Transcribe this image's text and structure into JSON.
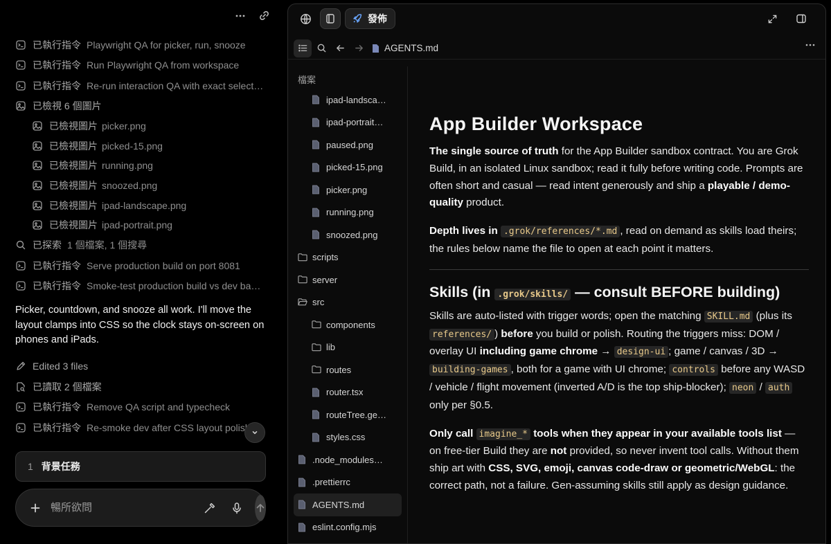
{
  "chat": {
    "log": [
      {
        "icon": "terminal-icon",
        "label": "已執行指令",
        "detail": "Playwright QA for picker, run, snooze"
      },
      {
        "icon": "terminal-icon",
        "label": "已執行指令",
        "detail": "Run Playwright QA from workspace"
      },
      {
        "icon": "terminal-icon",
        "label": "已執行指令",
        "detail": "Re-run interaction QA with exact select…"
      },
      {
        "icon": "image-icon",
        "label": "已檢視 6 個圖片",
        "detail": ""
      }
    ],
    "images": [
      {
        "label": "已檢視圖片",
        "detail": "picker.png"
      },
      {
        "label": "已檢視圖片",
        "detail": "picked-15.png"
      },
      {
        "label": "已檢視圖片",
        "detail": "running.png"
      },
      {
        "label": "已檢視圖片",
        "detail": "snoozed.png"
      },
      {
        "label": "已檢視圖片",
        "detail": "ipad-landscape.png"
      },
      {
        "label": "已檢視圖片",
        "detail": "ipad-portrait.png"
      }
    ],
    "log2": [
      {
        "icon": "search-icon",
        "label": "已探索",
        "detail": "1 個檔案, 1 個搜尋"
      },
      {
        "icon": "terminal-icon",
        "label": "已執行指令",
        "detail": "Serve production build on port 8081"
      },
      {
        "icon": "terminal-icon",
        "label": "已執行指令",
        "detail": "Smoke-test production build vs dev ba…"
      }
    ],
    "message": "Picker, countdown, and snooze all work. I'll move the layout clamps into CSS so the clock stays on-screen on phones and iPads.",
    "log3": [
      {
        "icon": "pencil-icon",
        "label": "Edited 3 files",
        "detail": ""
      },
      {
        "icon": "file-search-icon",
        "label": "已讀取 2 個檔案",
        "detail": ""
      },
      {
        "icon": "terminal-icon",
        "label": "已執行指令",
        "detail": "Remove QA script and typecheck"
      },
      {
        "icon": "terminal-icon",
        "label": "已執行指令",
        "detail": "Re-smoke dev after CSS layout polish"
      }
    ],
    "background_task": {
      "count": "1",
      "label": "背景任務"
    },
    "composer_placeholder": "暢所欲問"
  },
  "preview": {
    "publish_label": "發佈",
    "file_name": "AGENTS.md",
    "tree_header": "檔案",
    "tree": [
      {
        "kind": "file",
        "depth": 1,
        "name": "ipad-landsca…"
      },
      {
        "kind": "file",
        "depth": 1,
        "name": "ipad-portrait…"
      },
      {
        "kind": "file",
        "depth": 1,
        "name": "paused.png"
      },
      {
        "kind": "file",
        "depth": 1,
        "name": "picked-15.png"
      },
      {
        "kind": "file",
        "depth": 1,
        "name": "picker.png"
      },
      {
        "kind": "file",
        "depth": 1,
        "name": "running.png"
      },
      {
        "kind": "file",
        "depth": 1,
        "name": "snoozed.png"
      },
      {
        "kind": "folder",
        "depth": 0,
        "name": "scripts"
      },
      {
        "kind": "folder",
        "depth": 0,
        "name": "server"
      },
      {
        "kind": "folder-open",
        "depth": 0,
        "name": "src"
      },
      {
        "kind": "folder",
        "depth": 1,
        "name": "components"
      },
      {
        "kind": "folder",
        "depth": 1,
        "name": "lib"
      },
      {
        "kind": "folder",
        "depth": 1,
        "name": "routes"
      },
      {
        "kind": "file",
        "depth": 1,
        "name": "router.tsx"
      },
      {
        "kind": "file",
        "depth": 1,
        "name": "routeTree.ge…"
      },
      {
        "kind": "file",
        "depth": 1,
        "name": "styles.css"
      },
      {
        "kind": "file",
        "depth": 0,
        "name": ".node_modules…"
      },
      {
        "kind": "file",
        "depth": 0,
        "name": ".prettierrc"
      },
      {
        "kind": "file",
        "depth": 0,
        "name": "AGENTS.md",
        "selected": true
      },
      {
        "kind": "file",
        "depth": 0,
        "name": "eslint.config.mjs"
      }
    ],
    "doc": {
      "title": "App Builder Workspace",
      "p1": [
        {
          "b": "The single source of truth"
        },
        {
          "t": " for the App Builder sandbox contract. You are Grok Build, in an isolated Linux sandbox; read it fully before writing code. Prompts are often short and casual — read intent generously and ship a "
        },
        {
          "b": "playable / demo-quality"
        },
        {
          "t": " product."
        }
      ],
      "p2": [
        {
          "b": "Depth lives in "
        },
        {
          "c": ".grok/references/*.md"
        },
        {
          "t": ", read on demand as skills load theirs; the rules below name the file to open at each point it matters."
        }
      ],
      "h2": [
        {
          "t": "Skills (in "
        },
        {
          "c": ".grok/skills/"
        },
        {
          "t": " — consult BEFORE building)"
        }
      ],
      "p3": [
        {
          "t": "Skills are auto-listed with trigger words; open the matching "
        },
        {
          "c": "SKILL.md"
        },
        {
          "t": " (plus its "
        },
        {
          "c": "references/"
        },
        {
          "t": ") "
        },
        {
          "b": "before"
        },
        {
          "t": " you build or polish. Routing the triggers miss: DOM / overlay UI "
        },
        {
          "b": "including game chrome"
        },
        {
          "t": " → "
        },
        {
          "c": "design-ui"
        },
        {
          "t": "; game / canvas / 3D → "
        },
        {
          "c": "building-games"
        },
        {
          "t": ", both for a game with UI chrome; "
        },
        {
          "c": "controls"
        },
        {
          "t": " before any WASD / vehicle / flight movement (inverted A/D is the top ship-blocker); "
        },
        {
          "c": "neon"
        },
        {
          "t": " / "
        },
        {
          "c": "auth"
        },
        {
          "t": " only per §0.5."
        }
      ],
      "p4": [
        {
          "b": "Only call "
        },
        {
          "c": "imagine_*"
        },
        {
          "b": " tools when they appear in your available tools list"
        },
        {
          "t": " — on free-tier Build they are "
        },
        {
          "b": "not"
        },
        {
          "t": " provided, so never invent tool calls. Without them ship art with "
        },
        {
          "b": "CSS, SVG, emoji, canvas code-draw or geometric/WebGL"
        },
        {
          "t": ": the correct path, not a failure. Gen-assuming skills still apply as design guidance."
        }
      ]
    }
  }
}
